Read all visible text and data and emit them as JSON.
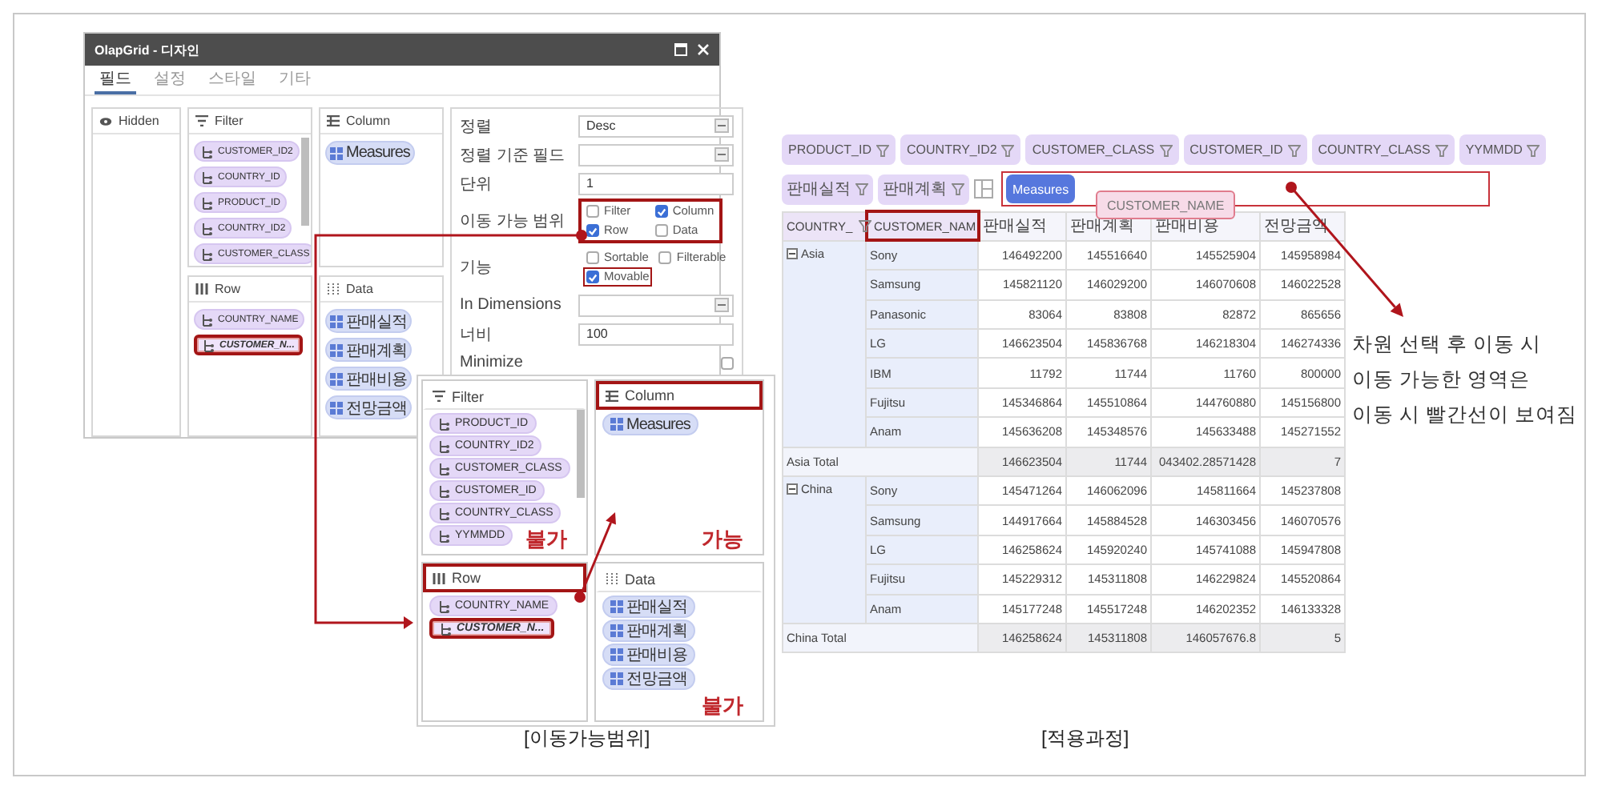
{
  "design_figure": {
    "dialog": {
      "title": "OlapGrid - 디자인",
      "tabs": [
        {
          "label": "필드",
          "selected": true
        },
        {
          "label": "설정",
          "selected": false
        },
        {
          "label": "스타일",
          "selected": false
        },
        {
          "label": "기타",
          "selected": false
        }
      ],
      "panels": [
        {
          "kind": "hidden",
          "title": "Hidden"
        },
        {
          "kind": "filter",
          "title": "Filter",
          "items": [
            {
              "label": "CUSTOMER_ID2",
              "kind": "dimension"
            },
            {
              "label": "COUNTRY_ID",
              "kind": "dimension"
            },
            {
              "label": "PRODUCT_ID",
              "kind": "dimension"
            },
            {
              "label": "COUNTRY_ID2",
              "kind": "dimension"
            },
            {
              "label": "CUSTOMER_CLASS",
              "kind": "dimension"
            }
          ]
        },
        {
          "kind": "column",
          "title": "Column",
          "items": [
            {
              "label": "Measures",
              "kind": "measure"
            }
          ]
        },
        {
          "kind": "row",
          "title": "Row",
          "items": [
            {
              "label": "COUNTRY_NAME",
              "kind": "dimension",
              "highlighted": false
            },
            {
              "label": "CUSTOMER_N...",
              "kind": "dimension",
              "highlighted": true
            }
          ]
        },
        {
          "kind": "data",
          "title": "Data",
          "items": [
            {
              "label": "판매실적",
              "kind": "measure"
            },
            {
              "label": "판매계획",
              "kind": "measure"
            },
            {
              "label": "판매비용",
              "kind": "measure"
            },
            {
              "label": "전망금액",
              "kind": "measure"
            }
          ]
        }
      ],
      "properties": [
        {
          "kind": "select",
          "label": "정렬",
          "value": "Desc"
        },
        {
          "kind": "select",
          "label": "정렬 기준 필드"
        },
        {
          "kind": "text",
          "label": "단위",
          "value": "1"
        },
        {
          "kind": "checkboxes",
          "label": "이동 가능 범위",
          "highlighted": true,
          "options": [
            {
              "label": "Filter",
              "checked": false,
              "highlighted": false
            },
            {
              "label": "Column",
              "checked": true,
              "highlighted": false
            },
            {
              "label": "Row",
              "checked": true,
              "highlighted": false
            },
            {
              "label": "Data",
              "checked": false,
              "highlighted": false
            }
          ]
        },
        {
          "kind": "checkboxes",
          "label": "기능",
          "highlighted": false,
          "options": [
            {
              "label": "Sortable",
              "checked": false,
              "highlighted": false
            },
            {
              "label": "Filterable",
              "checked": false,
              "highlighted": false
            },
            {
              "label": "Movable",
              "checked": true,
              "highlighted": true
            }
          ]
        },
        {
          "kind": "select",
          "label": "In Dimensions"
        },
        {
          "kind": "text",
          "label": "너비",
          "value": "100"
        },
        {
          "kind": "checkbox",
          "label": "Minimize",
          "checked": false
        }
      ]
    },
    "inset": {
      "panels": [
        {
          "kind": "filter",
          "title": "Filter",
          "highlighted": false,
          "note": "불가",
          "items": [
            {
              "label": "PRODUCT_ID",
              "kind": "dimension"
            },
            {
              "label": "COUNTRY_ID2",
              "kind": "dimension"
            },
            {
              "label": "CUSTOMER_CLASS",
              "kind": "dimension"
            },
            {
              "label": "CUSTOMER_ID",
              "kind": "dimension"
            },
            {
              "label": "COUNTRY_CLASS",
              "kind": "dimension"
            },
            {
              "label": "YYMMDD",
              "kind": "dimension"
            }
          ]
        },
        {
          "kind": "column",
          "title": "Column",
          "highlighted": true,
          "note": "가능",
          "items": [
            {
              "label": "Measures",
              "kind": "measure"
            }
          ]
        },
        {
          "kind": "row",
          "title": "Row",
          "highlighted": true,
          "items": [
            {
              "label": "COUNTRY_NAME",
              "kind": "dimension",
              "highlighted": false
            },
            {
              "label": "CUSTOMER_N...",
              "kind": "dimension",
              "highlighted": true
            }
          ]
        },
        {
          "kind": "data",
          "title": "Data",
          "highlighted": false,
          "note": "불가",
          "items": [
            {
              "label": "판매실적",
              "kind": "measure"
            },
            {
              "label": "판매계획",
              "kind": "measure"
            },
            {
              "label": "판매비용",
              "kind": "measure"
            },
            {
              "label": "전망금액",
              "kind": "measure"
            }
          ]
        }
      ]
    },
    "caption": "[이동가능범위]"
  },
  "applied_figure": {
    "filter_chips": [
      "PRODUCT_ID",
      "COUNTRY_ID2",
      "CUSTOMER_CLASS",
      "CUSTOMER_ID",
      "COUNTRY_CLASS",
      "YYMMDD"
    ],
    "data_chips": [
      "판매실적",
      "판매계획"
    ],
    "column_area": {
      "highlighted": true,
      "chips": [
        "Measures"
      ]
    },
    "drag_ghost": "CUSTOMER_NAME",
    "table": {
      "row_headers": [
        {
          "label": "COUNTRY_",
          "highlighted": false
        },
        {
          "label": "CUSTOMER_NAM",
          "highlighted": true
        }
      ],
      "columns": [
        "판매실적",
        "판매계획",
        "판매비용",
        "전망금액"
      ],
      "groups": [
        {
          "label": "Asia",
          "expanded": true,
          "rows": [
            {
              "label": "Sony",
              "values": [
                "146492200",
                "145516640",
                "145525904",
                "145958984"
              ]
            },
            {
              "label": "Samsung",
              "values": [
                "145821120",
                "146029200",
                "146070608",
                "146022528"
              ]
            },
            {
              "label": "Panasonic",
              "values": [
                "83064",
                "83808",
                "82872",
                "865656"
              ]
            },
            {
              "label": "LG",
              "values": [
                "146623504",
                "145836768",
                "146218304",
                "146274336"
              ]
            },
            {
              "label": "IBM",
              "values": [
                "11792",
                "11744",
                "11760",
                "800000"
              ]
            },
            {
              "label": "Fujitsu",
              "values": [
                "145346864",
                "145510864",
                "144760880",
                "145156800"
              ]
            },
            {
              "label": "Anam",
              "values": [
                "145636208",
                "145348576",
                "145633488",
                "145271552"
              ]
            }
          ],
          "total": {
            "label": "Asia Total",
            "values": [
              "146623504",
              "11744",
              "043402.28571428",
              "7"
            ]
          }
        },
        {
          "label": "China",
          "expanded": true,
          "rows": [
            {
              "label": "Sony",
              "values": [
                "145471264",
                "146062096",
                "145811664",
                "145237808"
              ]
            },
            {
              "label": "Samsung",
              "values": [
                "144917664",
                "145884528",
                "146303456",
                "146070576"
              ]
            },
            {
              "label": "LG",
              "values": [
                "146258624",
                "145920240",
                "145741088",
                "145947808"
              ]
            },
            {
              "label": "Fujitsu",
              "values": [
                "145229312",
                "145311808",
                "146229824",
                "145520864"
              ]
            },
            {
              "label": "Anam",
              "values": [
                "145177248",
                "145517248",
                "146202352",
                "146133328"
              ]
            }
          ],
          "total": {
            "label": "China Total",
            "values": [
              "146258624",
              "145311808",
              "146057676.8",
              "5"
            ]
          }
        }
      ]
    },
    "note": "차원 선택 후 이동 시\n이동 가능한 영역은\n이동 시 빨간선이 보여짐",
    "caption": "[적용과정]"
  }
}
